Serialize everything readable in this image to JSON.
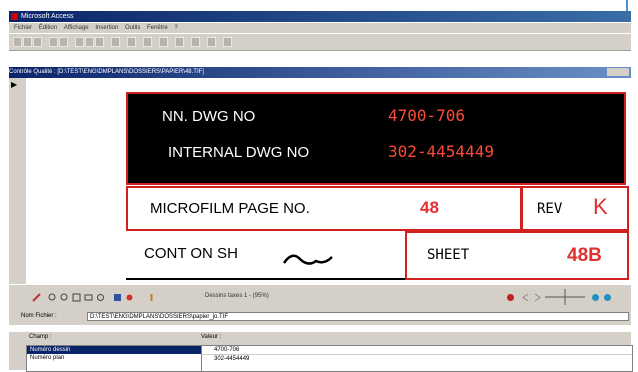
{
  "app": {
    "title": "Microsoft Access"
  },
  "menu": [
    "Fichier",
    "Édition",
    "Affichage",
    "Insertion",
    "Outils",
    "Fenêtre",
    "?"
  ],
  "child_window": {
    "title": "Contrôle Qualité : [D:\\TEST\\ENG\\DMPLANS\\DOSSIERS\\PAPIER\\48.TIF]"
  },
  "drawing": {
    "nn_label": "NN. DWG NO",
    "nn_value": "4700-706",
    "internal_label": "INTERNAL DWG NO",
    "internal_value": "302-4454449",
    "microfilm_label": "MICROFILM PAGE NO.",
    "microfilm_value": "48",
    "rev_label": "REV",
    "rev_value": "K",
    "cont_label": "CONT ON SH",
    "sheet_label": "SHEET",
    "sheet_value": "48B"
  },
  "viewer": {
    "zoom_text": "Dessins taxes 1 - (95%)"
  },
  "filename": {
    "label": "Nom Fichier :",
    "value": "D:\\TEST\\ENG\\DMPLANS\\DOSSIERS\\papier_jo.TIF"
  },
  "bottom": {
    "left_label": "Champ :",
    "right_label": "Valeur :",
    "items": [
      "Numéro dessin",
      "Numéro plan"
    ],
    "values": [
      "4700-706",
      "302-4454449"
    ]
  }
}
